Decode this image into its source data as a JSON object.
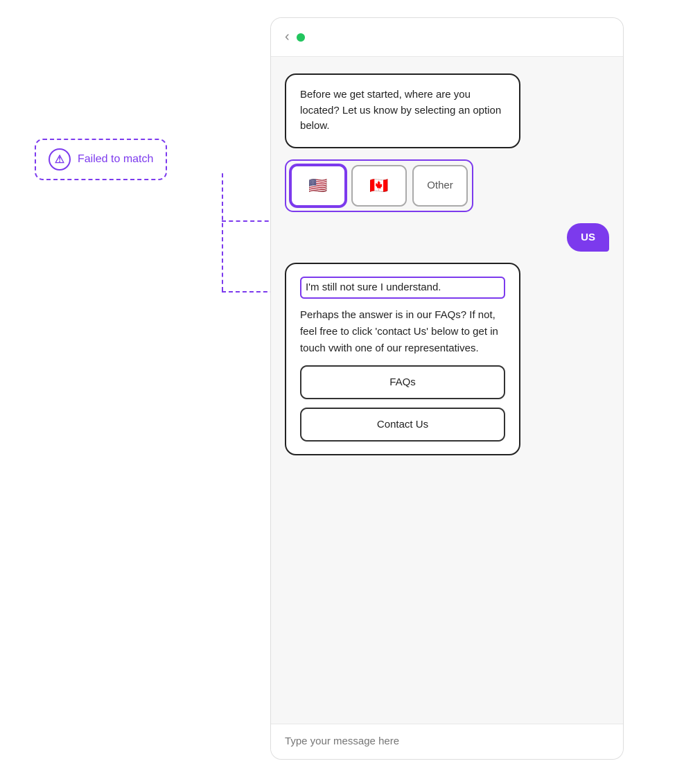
{
  "header": {
    "back_label": "‹",
    "status_color": "#22c55e"
  },
  "chat": {
    "bot_message_1": "Before we get started, where are you located? Let us know by selecting an option below.",
    "options": [
      {
        "id": "us",
        "label": "🇺🇸",
        "selected": true
      },
      {
        "id": "ca",
        "label": "🇨🇦",
        "selected": false
      },
      {
        "id": "other",
        "label": "Other",
        "selected": false
      }
    ],
    "user_reply": "US",
    "response_first_line": "I'm still not sure I understand.",
    "response_body": "Perhaps the answer is in our FAQs? If not, feel free to click 'contact Us' below to get in touch vwith one of our representatives.",
    "faq_button": "FAQs",
    "contact_button": "Contact Us",
    "input_placeholder": "Type your message here"
  },
  "annotation": {
    "label": "Failed to match",
    "icon": "⚠"
  },
  "warning_icon": "⚠"
}
